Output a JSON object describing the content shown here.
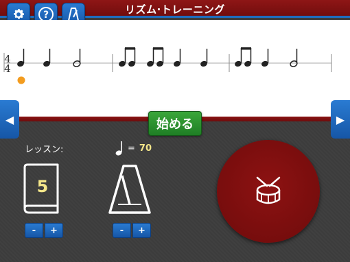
{
  "header": {
    "title": "リズム·トレーニング",
    "buttons": [
      {
        "icon": "gear-icon"
      },
      {
        "icon": "help-icon",
        "glyph": "?"
      },
      {
        "icon": "metronome-icon"
      }
    ]
  },
  "staff": {
    "time_signature_top": "4",
    "time_signature_bottom": "4",
    "measures": [
      [
        "quarter",
        "quarter",
        "half"
      ],
      [
        "eighth-pair",
        "eighth-pair",
        "quarter",
        "quarter"
      ],
      [
        "eighth-pair",
        "quarter",
        "half"
      ]
    ],
    "cursor_color": "#f39c1f"
  },
  "nav": {
    "prev_glyph": "◀",
    "next_glyph": "▶"
  },
  "start_button": {
    "label": "始める"
  },
  "lesson": {
    "label": "レッスン:",
    "number": "5",
    "minus": "-",
    "plus": "+"
  },
  "tempo": {
    "equals": "=",
    "value": "70",
    "minus": "-",
    "plus": "+"
  },
  "drum_button": {
    "icon": "drum-icon"
  },
  "colors": {
    "header_red": "#8e1616",
    "accent_blue": "#1e6ec0",
    "start_green": "#2e9a33",
    "lesson_number": "#f5e78a"
  }
}
